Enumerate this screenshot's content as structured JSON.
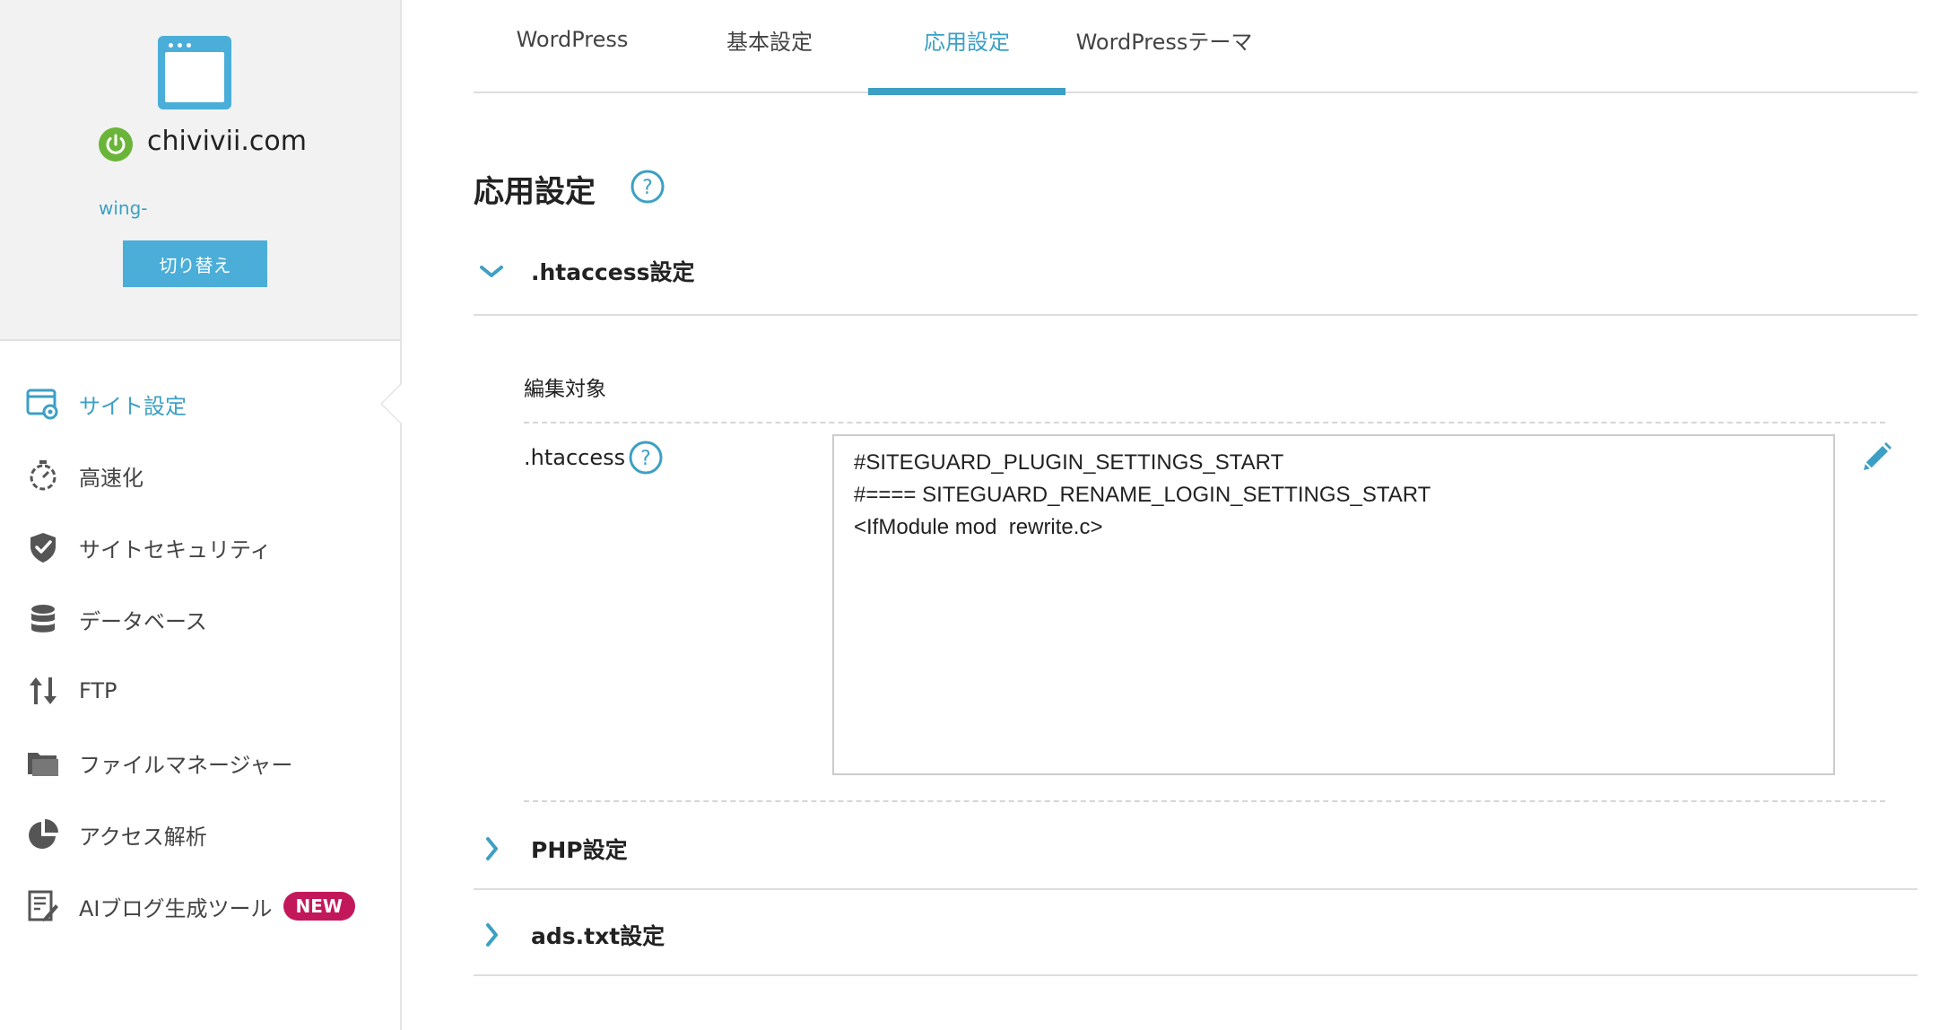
{
  "site": {
    "domain": "chivivii.com",
    "account": "wing-",
    "switch_label": "切り替え",
    "status_color": "#6bb43a",
    "accent_color": "#4aaed9"
  },
  "sidebar": {
    "items": [
      {
        "label": "サイト設定",
        "icon": "site-settings-icon",
        "active": true
      },
      {
        "label": "高速化",
        "icon": "stopwatch-icon",
        "active": false
      },
      {
        "label": "サイトセキュリティ",
        "icon": "shield-check-icon",
        "active": false
      },
      {
        "label": "データベース",
        "icon": "database-icon",
        "active": false
      },
      {
        "label": "FTP",
        "icon": "up-down-arrows-icon",
        "active": false
      },
      {
        "label": "ファイルマネージャー",
        "icon": "folder-icon",
        "active": false
      },
      {
        "label": "アクセス解析",
        "icon": "pie-chart-icon",
        "active": false
      },
      {
        "label": "AIブログ生成ツール",
        "icon": "document-pen-icon",
        "active": false,
        "badge": "NEW"
      }
    ]
  },
  "tabs": [
    {
      "label": "WordPress",
      "active": false
    },
    {
      "label": "基本設定",
      "active": false
    },
    {
      "label": "応用設定",
      "active": true
    },
    {
      "label": "WordPressテーマ",
      "active": false
    }
  ],
  "main": {
    "title": "応用設定",
    "sections": [
      {
        "title": ".htaccess設定",
        "expanded": true
      },
      {
        "title": "PHP設定",
        "expanded": false
      },
      {
        "title": "ads.txt設定",
        "expanded": false
      }
    ],
    "htaccess": {
      "edit_target_label": "編集対象",
      "field_label": ".htaccess",
      "content": "#SITEGUARD_PLUGIN_SETTINGS_START\n#==== SITEGUARD_RENAME_LOGIN_SETTINGS_START\n<IfModule mod_rewrite.c>"
    }
  },
  "colors": {
    "accent": "#3ca0c4",
    "new_badge": "#c2185b"
  }
}
